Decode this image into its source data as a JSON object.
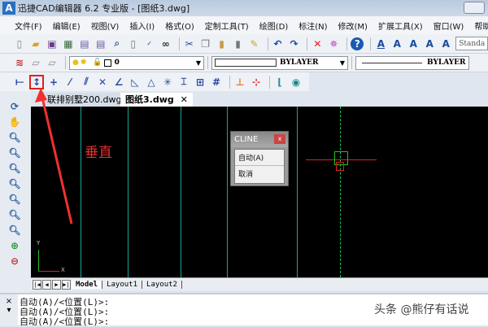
{
  "window": {
    "title": "迅捷CAD编辑器 6.2 专业版  - [图纸3.dwg]",
    "logo": "A"
  },
  "menu": [
    "文件(F)",
    "编辑(E)",
    "视图(V)",
    "插入(I)",
    "格式(O)",
    "定制工具(T)",
    "绘图(D)",
    "标注(N)",
    "修改(M)",
    "扩展工具(X)",
    "窗口(W)",
    "帮助(H)"
  ],
  "toolbar": {
    "text_style": "Standa",
    "layer_value": "0",
    "color_value": "BYLAYER",
    "linetype_value": "BYLAYER"
  },
  "file_tabs": [
    {
      "label": "联排别墅200.dwg"
    },
    {
      "label": "图纸3.dwg",
      "active": true,
      "close": "✕"
    }
  ],
  "annotation": {
    "text": "垂直",
    "color": "#e03030"
  },
  "popup": {
    "title": "CLINE",
    "close": "x",
    "items": [
      "自动(A)",
      "取消"
    ]
  },
  "ucs": {
    "x": "X",
    "y": "Y"
  },
  "layout_tabs": [
    "Model",
    "Layout1",
    "Layout2"
  ],
  "command": {
    "lines": [
      "自动(A)/<位置(L)>:",
      "自动(A)/<位置(L)>:",
      "自动(A)/<位置(L)>:"
    ],
    "close": "×",
    "dropdown": "▾"
  },
  "watermark": "头条 @熊仔有话说",
  "colors": {
    "canvas": "#000000",
    "construction_line": "#1aa39a",
    "crosshair": "#e02020",
    "cursor_box": "#20c020"
  }
}
